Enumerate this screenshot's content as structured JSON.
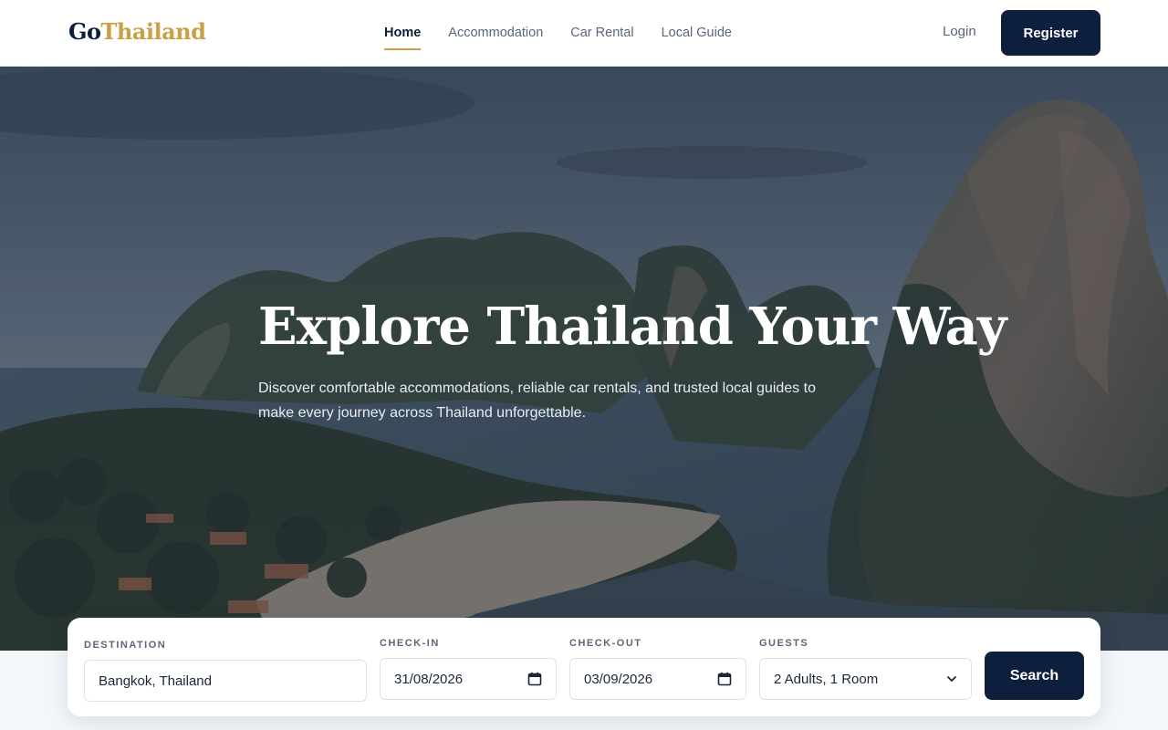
{
  "brand": {
    "part1": "Go",
    "part2": "Thailand"
  },
  "nav": {
    "items": [
      {
        "label": "Home",
        "active": true
      },
      {
        "label": "Accommodation",
        "active": false
      },
      {
        "label": "Car Rental",
        "active": false
      },
      {
        "label": "Local Guide",
        "active": false
      }
    ],
    "login_label": "Login",
    "register_label": "Register"
  },
  "hero": {
    "title": "Explore Thailand Your Way",
    "subtitle": "Discover comfortable accommodations, reliable car rentals, and trusted local guides to make every journey across Thailand unforgettable."
  },
  "search": {
    "destination": {
      "label": "DESTINATION",
      "value": "Bangkok, Thailand"
    },
    "checkin": {
      "label": "CHECK-IN",
      "value": "31/08/2026"
    },
    "checkout": {
      "label": "CHECK-OUT",
      "value": "03/09/2026"
    },
    "guests": {
      "label": "GUESTS",
      "value": "2 Adults, 1 Room"
    },
    "button_label": "Search"
  },
  "colors": {
    "navy": "#0d1f3c",
    "gold": "#c9a045",
    "muted": "#5b6677"
  },
  "icons": {
    "date_picker": "calendar-icon",
    "select": "chevron-down-icon"
  }
}
